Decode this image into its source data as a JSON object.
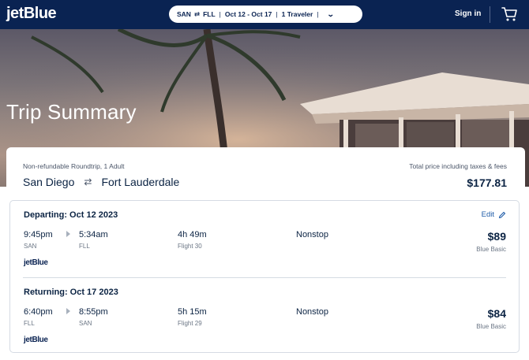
{
  "nav": {
    "logo": "jetBlue",
    "search": {
      "origin": "SAN",
      "arrow": "⇄",
      "destination": "FLL",
      "dates": "Oct 12 - Oct 17",
      "travelers": "1 Traveler",
      "chevron": "⌄"
    },
    "signin": "Sign in",
    "cart_icon": "cart-icon"
  },
  "hero": {
    "title": "Trip Summary"
  },
  "summary": {
    "trip_type": "Non-refundable Roundtrip, 1 Adult",
    "origin_city": "San Diego",
    "swap_glyph": "⇄",
    "destination_city": "Fort Lauderdale",
    "total_label": "Total price including taxes & fees",
    "total_price": "$177.81"
  },
  "legs": [
    {
      "title": "Departing: Oct 12 2023",
      "edit_label": "Edit",
      "depart_time": "9:45pm",
      "depart_code": "SAN",
      "arrive_time": "5:34am",
      "arrive_code": "FLL",
      "duration": "4h 49m",
      "flight": "Flight 30",
      "stops": "Nonstop",
      "price": "$89",
      "fare": "Blue Basic",
      "airline": "jetBlue"
    },
    {
      "title": "Returning: Oct 17 2023",
      "depart_time": "6:40pm",
      "depart_code": "FLL",
      "arrive_time": "8:55pm",
      "arrive_code": "SAN",
      "duration": "5h 15m",
      "flight": "Flight 29",
      "stops": "Nonstop",
      "price": "$84",
      "fare": "Blue Basic",
      "airline": "jetBlue"
    }
  ],
  "colors": {
    "nav_bg": "#0a2352",
    "text_primary": "#0b2343",
    "link": "#1f5ca8"
  }
}
